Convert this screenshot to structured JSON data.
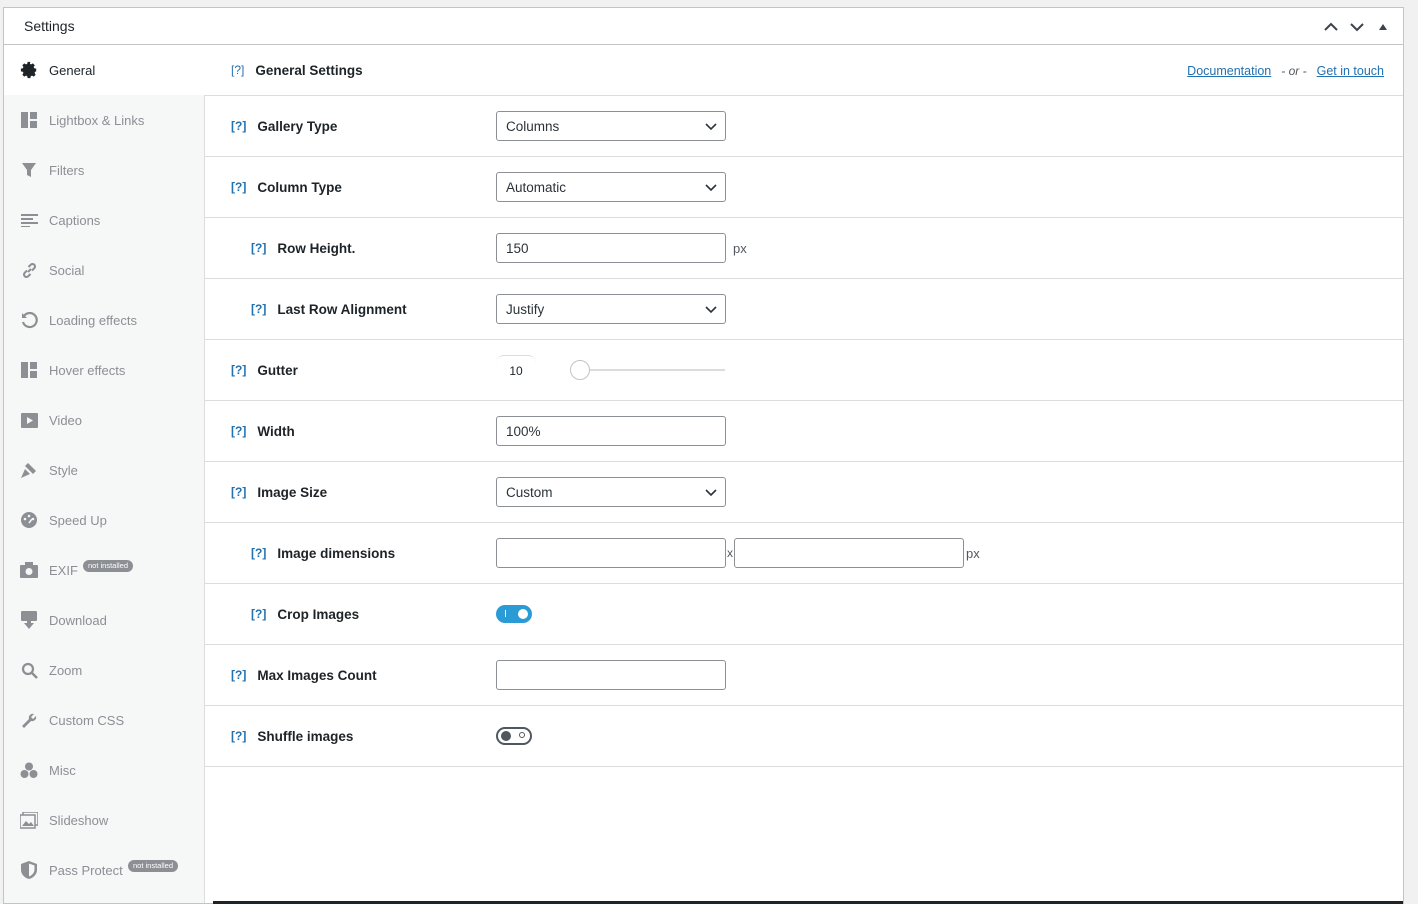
{
  "panel": {
    "title": "Settings",
    "controls": [
      "chevron-up",
      "chevron-down",
      "triangle-up"
    ]
  },
  "sidebar": {
    "items": [
      {
        "label": "General",
        "icon": "gear-icon",
        "active": true
      },
      {
        "label": "Lightbox & Links",
        "icon": "grid-icon"
      },
      {
        "label": "Filters",
        "icon": "filter-icon"
      },
      {
        "label": "Captions",
        "icon": "captions-icon"
      },
      {
        "label": "Social",
        "icon": "link-icon"
      },
      {
        "label": "Loading effects",
        "icon": "refresh-icon"
      },
      {
        "label": "Hover effects",
        "icon": "grid-icon"
      },
      {
        "label": "Video",
        "icon": "video-icon"
      },
      {
        "label": "Style",
        "icon": "brush-icon"
      },
      {
        "label": "Speed Up",
        "icon": "dashboard-icon"
      },
      {
        "label": "EXIF",
        "icon": "camera-icon",
        "badge": "not installed"
      },
      {
        "label": "Download",
        "icon": "download-icon"
      },
      {
        "label": "Zoom",
        "icon": "search-icon"
      },
      {
        "label": "Custom CSS",
        "icon": "wrench-icon"
      },
      {
        "label": "Misc",
        "icon": "circles-icon"
      },
      {
        "label": "Slideshow",
        "icon": "slides-icon"
      },
      {
        "label": "Pass Protect",
        "icon": "shield-icon",
        "badge": "not installed"
      }
    ]
  },
  "header": {
    "help": "[?]",
    "title": "General Settings",
    "doc_link": "Documentation",
    "or_text": "- or -",
    "contact_link": "Get in touch"
  },
  "fields": {
    "gallery_type": {
      "label": "Gallery Type",
      "value": "Columns"
    },
    "column_type": {
      "label": "Column Type",
      "value": "Automatic"
    },
    "row_height": {
      "label": "Row Height.",
      "value": "150",
      "unit": "px"
    },
    "last_row": {
      "label": "Last Row Alignment",
      "value": "Justify"
    },
    "gutter": {
      "label": "Gutter",
      "value": "10",
      "slider_fraction": 0
    },
    "width": {
      "label": "Width",
      "value": "100%"
    },
    "image_size": {
      "label": "Image Size",
      "value": "Custom"
    },
    "image_dimensions": {
      "label": "Image dimensions",
      "width": "",
      "height": "",
      "sep": "x",
      "unit": "px"
    },
    "crop_images": {
      "label": "Crop Images",
      "on": true
    },
    "max_images": {
      "label": "Max Images Count",
      "value": ""
    },
    "shuffle_images": {
      "label": "Shuffle images",
      "on": false
    }
  },
  "colors": {
    "accent": "#2271b1",
    "toggle_on": "#2b9bd6"
  }
}
